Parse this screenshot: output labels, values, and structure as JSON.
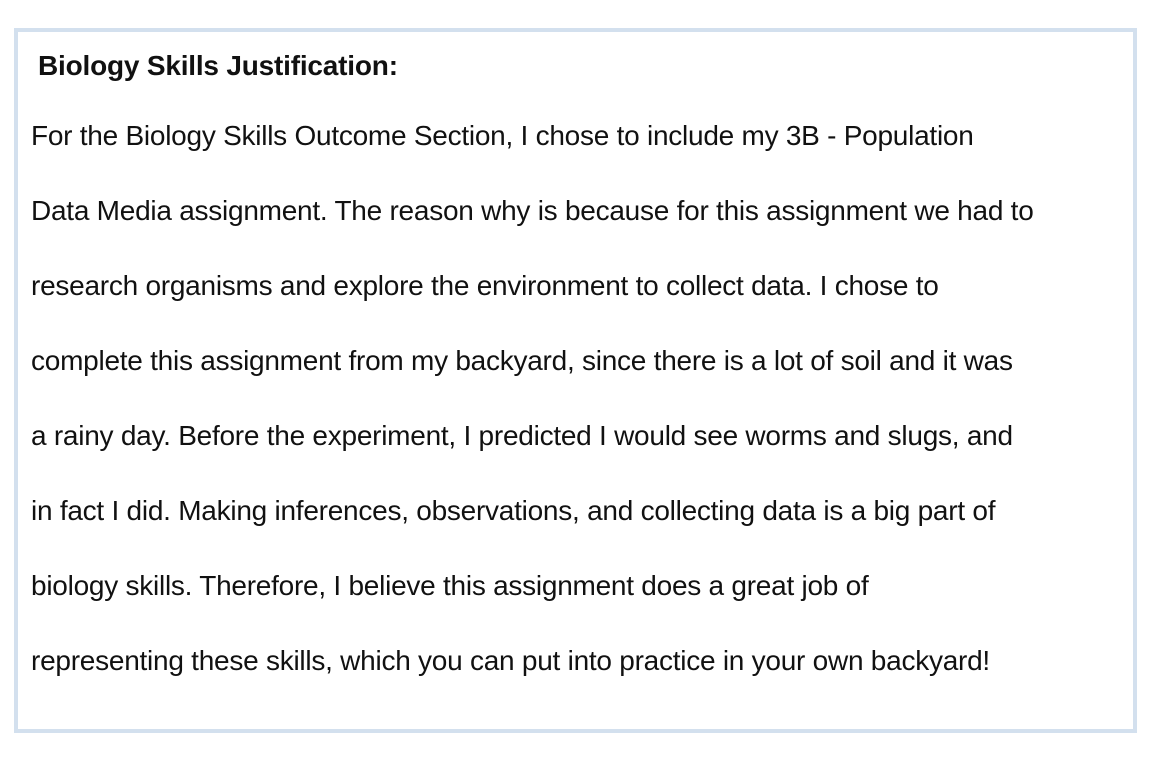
{
  "document": {
    "heading": "Biology Skills Justification:",
    "lines": [
      "For the Biology Skills Outcome Section, I chose to include my 3B - Population",
      "Data Media assignment. The reason why is because for this assignment we had to",
      "research organisms and explore the environment to collect data. I chose to",
      "complete this assignment from my backyard, since there is a lot of soil and it was",
      "a rainy day. Before the experiment, I predicted I would see worms and slugs, and",
      "in fact I did. Making inferences, observations, and collecting data is a big part of",
      "biology skills. Therefore, I believe this assignment does a great job of",
      "representing these skills, which you can put into practice in your own backyard!"
    ]
  },
  "colors": {
    "border": "#d3e0ee",
    "text": "#111111",
    "background": "#ffffff"
  }
}
